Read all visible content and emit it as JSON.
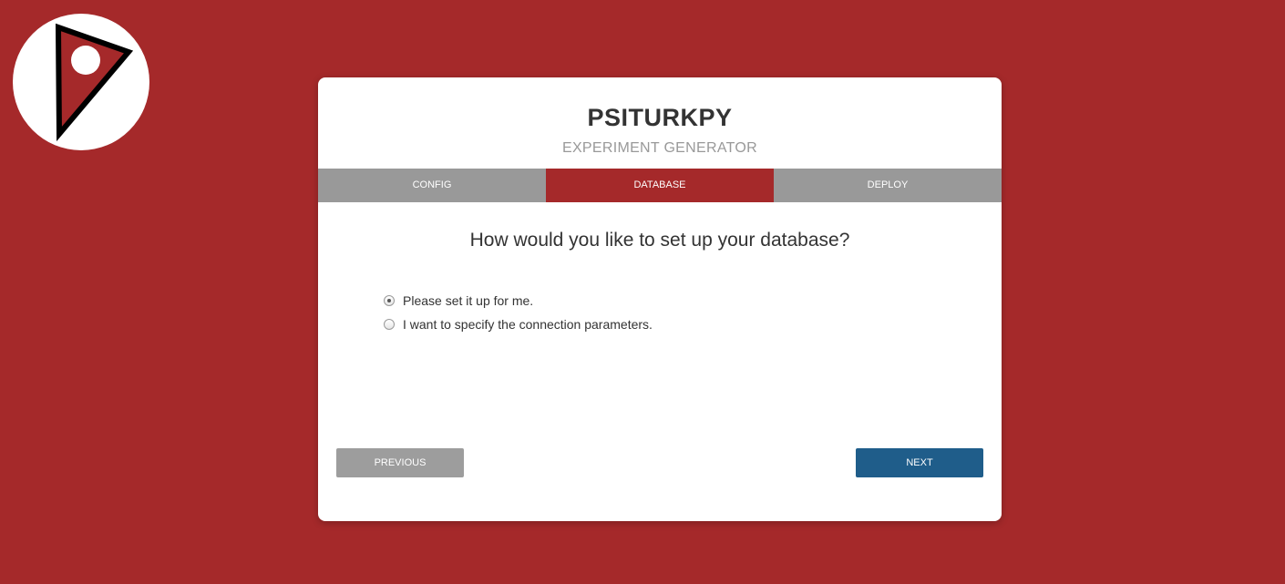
{
  "logo": {
    "icon": "pizza-slice-logo-icon"
  },
  "header": {
    "title": "PSITURKPY",
    "subtitle": "EXPERIMENT GENERATOR"
  },
  "tabs": [
    {
      "label": "CONFIG",
      "active": false
    },
    {
      "label": "DATABASE",
      "active": true
    },
    {
      "label": "DEPLOY",
      "active": false
    }
  ],
  "main": {
    "question": "How would you like to set up your database?",
    "options": [
      {
        "label": "Please set it up for me.",
        "selected": true
      },
      {
        "label": "I want to specify the connection parameters.",
        "selected": false
      }
    ]
  },
  "buttons": {
    "previous": "PREVIOUS",
    "next": "NEXT"
  },
  "colors": {
    "background": "#a5292a",
    "active_tab": "#a5292a",
    "inactive_tab": "#999999",
    "next_button": "#1f5d8a",
    "previous_button": "#9d9d9d"
  }
}
